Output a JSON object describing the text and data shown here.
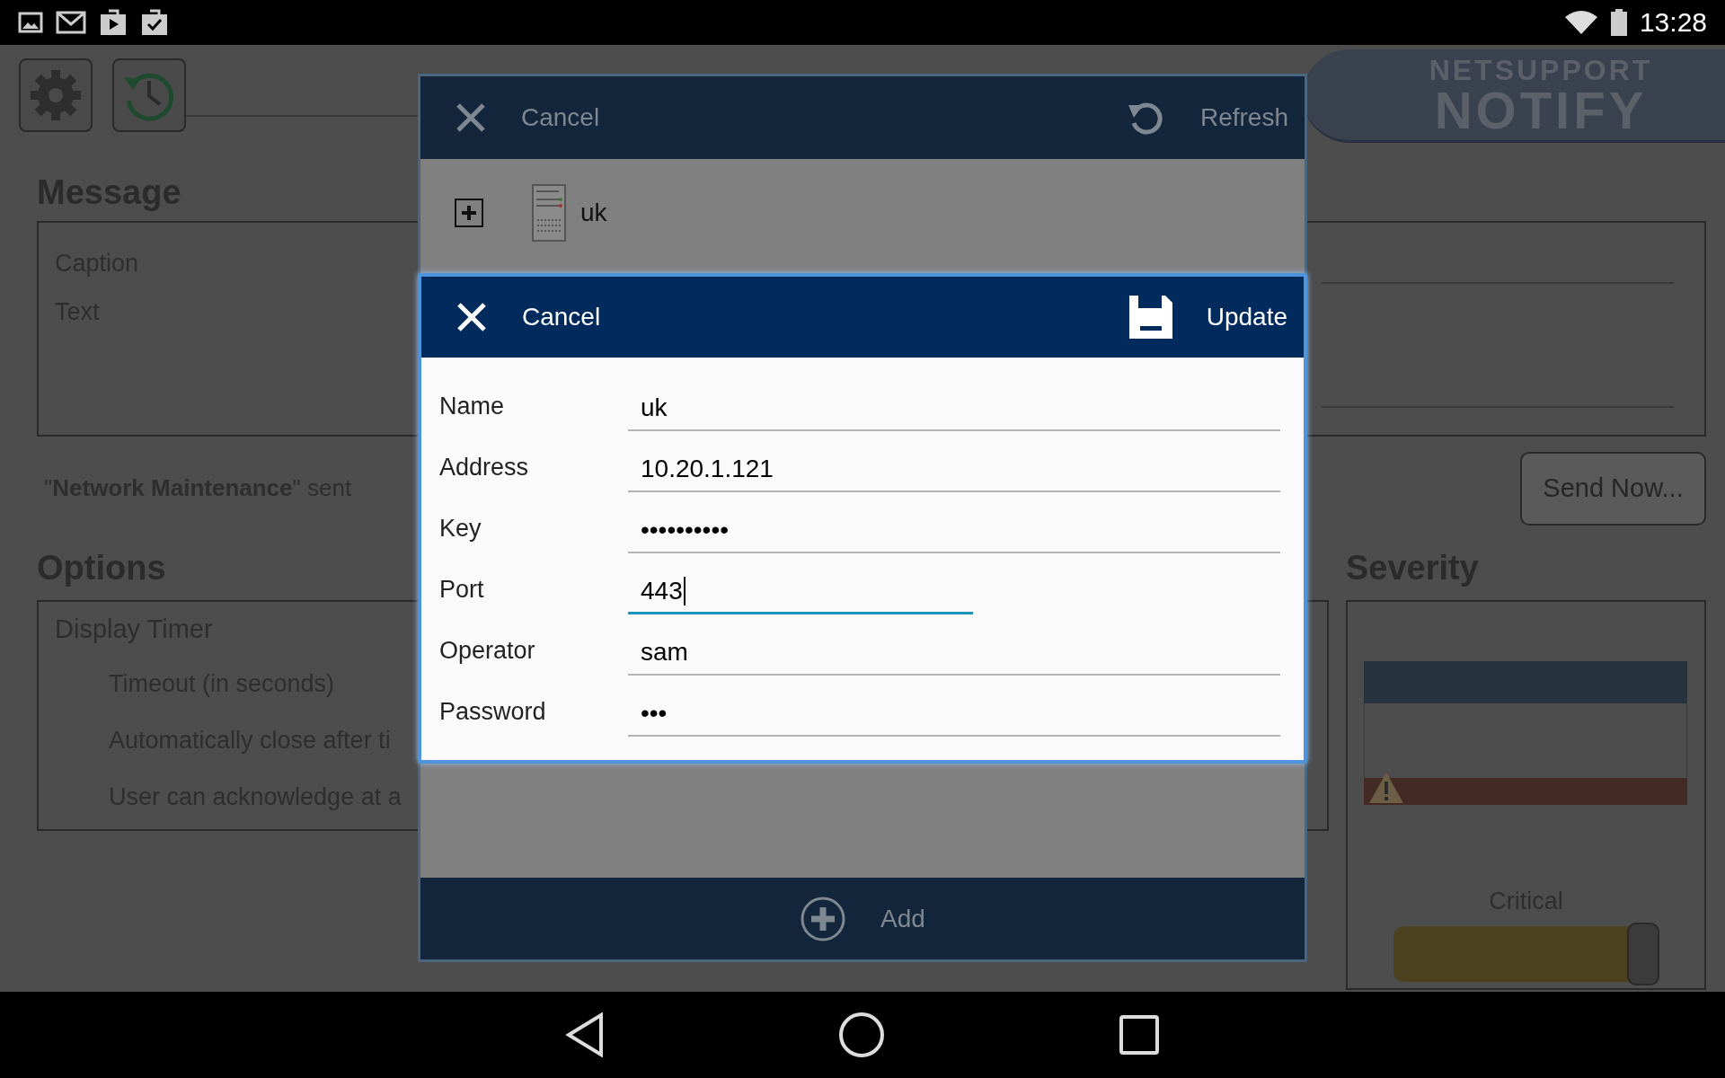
{
  "status_bar": {
    "time": "13:28"
  },
  "logo": {
    "line1": "NETSUPPORT",
    "line2": "NOTIFY"
  },
  "message": {
    "heading": "Message",
    "fields": [
      {
        "label": "Caption"
      },
      {
        "label": "Text"
      }
    ],
    "status": "\"**Network Maintenance**\" sent",
    "send_button": "Send Now..."
  },
  "options": {
    "heading": "Options",
    "group": "Display Timer",
    "items": [
      "Timeout (in seconds)",
      "Automatically close after ti",
      "User can acknowledge at a"
    ]
  },
  "severity": {
    "heading": "Severity",
    "level_label": "Critical",
    "level": 1.0
  },
  "server_dialog": {
    "cancel": "Cancel",
    "refresh": "Refresh",
    "tree": [
      {
        "label": "uk",
        "expanded": false
      }
    ],
    "add": "Add"
  },
  "edit_dialog": {
    "cancel": "Cancel",
    "update": "Update",
    "fields": [
      {
        "label": "Name",
        "value": "uk",
        "focused": false
      },
      {
        "label": "Address",
        "value": "10.20.1.121",
        "focused": false
      },
      {
        "label": "Key",
        "value": "••••••••••",
        "focused": false
      },
      {
        "label": "Port",
        "value": "443",
        "focused": true
      },
      {
        "label": "Operator",
        "value": "sam",
        "focused": false
      },
      {
        "label": "Password",
        "value": "•••",
        "focused": false
      }
    ]
  }
}
